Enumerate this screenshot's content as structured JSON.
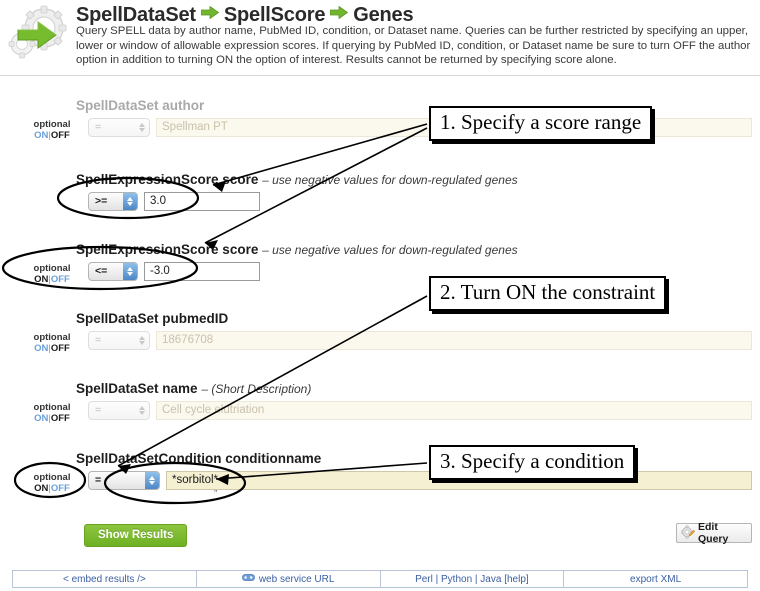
{
  "header": {
    "logo_icon": "gear-arrow-logo",
    "title_parts": [
      "SpellDataSet",
      "SpellScore",
      "Genes"
    ],
    "arrow_icon": "right-arrow-icon",
    "description": "Query SPELL data by author name, PubMed ID, condition, or Dataset name. Queries can be further restricted by specifying an upper, lower or window of allowable expression scores. If querying by PubMed ID, condition, or Dataset name be sure to turn OFF the author option in addition to turning ON the option of interest. Results cannot be returned by specifying score alone."
  },
  "labels": {
    "optional": "optional",
    "on": "ON",
    "off": "OFF",
    "separator": "|"
  },
  "rows": [
    {
      "id": "author",
      "label": "SpellDataSet author",
      "hint": "",
      "enabled": false,
      "operator": "=",
      "value": "Spellman PT",
      "spinner": "gray"
    },
    {
      "id": "score-upper",
      "label": "SpellExpressionScore score",
      "hint": "– use negative values for down-regulated genes",
      "enabled": true,
      "operator": ">=",
      "value": "3.0",
      "spinner": "blue"
    },
    {
      "id": "score-lower",
      "label": "SpellExpressionScore score",
      "hint": "– use negative values for down-regulated genes",
      "enabled": true,
      "operator": "<=",
      "value": "-3.0",
      "spinner": "blue"
    },
    {
      "id": "pubmedid",
      "label": "SpellDataSet pubmedID",
      "hint": "",
      "enabled": false,
      "operator": "=",
      "value": "18676708",
      "spinner": "gray"
    },
    {
      "id": "dataset-name",
      "label": "SpellDataSet name",
      "hint": "– (Short Description)",
      "enabled": false,
      "operator": "=",
      "value": "Cell cycle elutriation",
      "spinner": "gray"
    },
    {
      "id": "conditionname",
      "label": "SpellDataSetCondition conditionname",
      "hint": "",
      "enabled": true,
      "operator": "=",
      "value": "*sorbitol*",
      "spinner": "blue",
      "quote_mark": "”"
    }
  ],
  "actions": {
    "show_results": "Show Results",
    "edit_query": "Edit Query",
    "edit_query_icon": "gear-pencil-icon"
  },
  "footer": {
    "links": [
      {
        "text": "< embed results />",
        "icon": ""
      },
      {
        "text": "web service URL",
        "icon": "web-service-icon"
      },
      {
        "text": "Perl | Python | Java [help]",
        "icon": ""
      },
      {
        "text": "export XML",
        "icon": ""
      }
    ]
  },
  "annotations": [
    {
      "id": "callout-1",
      "text": "1. Specify a score range"
    },
    {
      "id": "callout-2",
      "text": "2. Turn ON the constraint"
    },
    {
      "id": "callout-3",
      "text": "3. Specify a condition"
    }
  ],
  "colors": {
    "accent_green": "#7fbb35",
    "link_blue": "#3b5fa4",
    "toggle_blue": "#6a9fd8",
    "disabled_field_bg": "#fbf8ee",
    "active_field_bg": "#f6f0d3"
  }
}
